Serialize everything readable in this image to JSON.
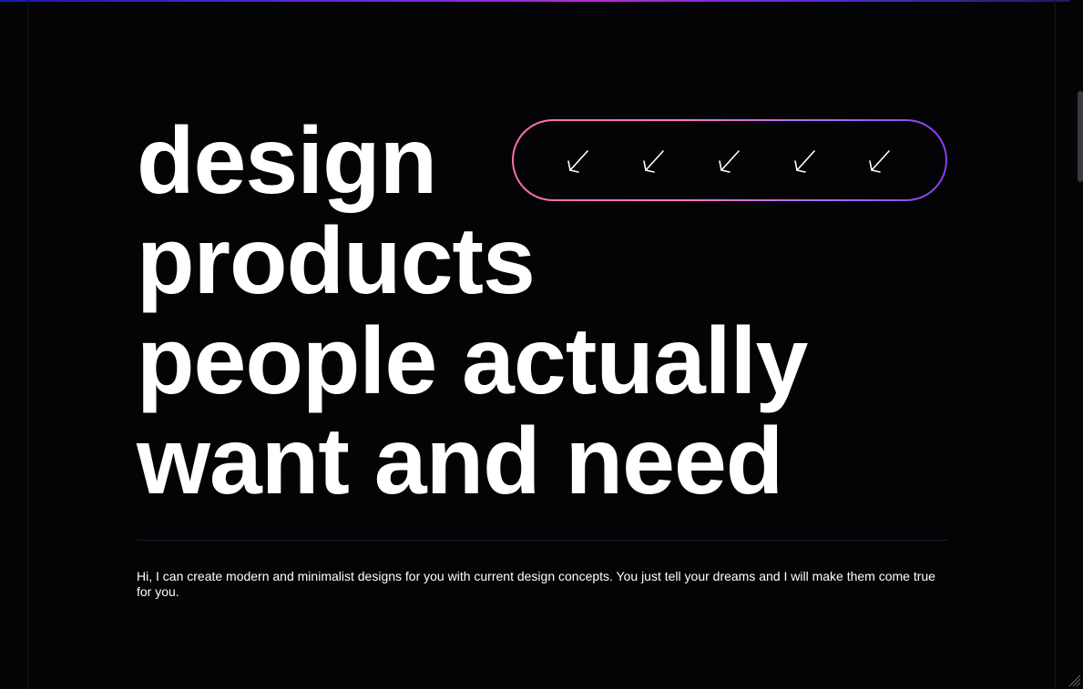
{
  "hero": {
    "headline_lines": [
      "design",
      "products",
      "people actually",
      "want and need"
    ],
    "intro_text": "Hi, I can create modern and minimalist designs for you with current design concepts. You just tell your dreams and I will make them come true for you."
  },
  "pill": {
    "icons": [
      "arrow-down-left-icon",
      "arrow-down-left-icon",
      "arrow-down-left-icon",
      "arrow-down-left-icon",
      "arrow-down-left-icon"
    ],
    "gradient_colors": [
      "#ff6ea8",
      "#f07cc6",
      "#a36bf2",
      "#8a3cf0"
    ]
  },
  "colors": {
    "background": "#040406",
    "text": "#ffffff",
    "divider": "#1d1d24"
  }
}
